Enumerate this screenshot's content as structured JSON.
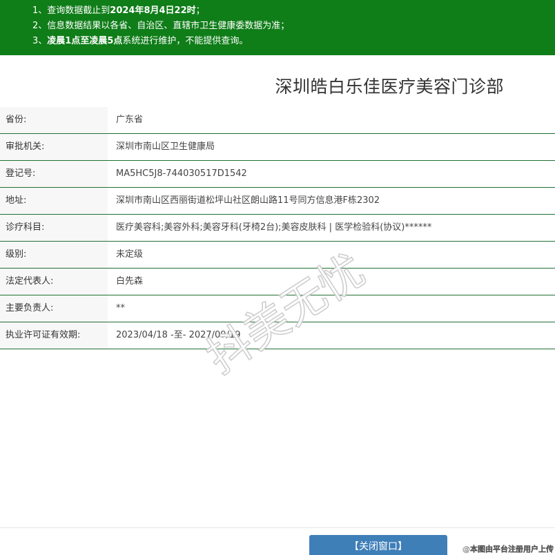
{
  "notice": {
    "line1_prefix": "1、查询数据截止到",
    "line1_bold": "2024年8月4日22时",
    "line1_suffix": "；",
    "line2": "2、信息数据结果以各省、自治区、直辖市卫生健康委数据为准；",
    "line3_prefix": "3、",
    "line3_bold": "凌晨1点至凌晨5点",
    "line3_suffix": "系统进行维护，不能提供查询。",
    "bg_color": "#0f7d18"
  },
  "title": "深圳皓白乐佳医疗美容门诊部",
  "rows": [
    {
      "label": "省份:",
      "value": "广东省"
    },
    {
      "label": "审批机关:",
      "value": "深圳市南山区卫生健康局"
    },
    {
      "label": "登记号:",
      "value": "MA5HC5J8-744030517D1542"
    },
    {
      "label": "地址:",
      "value": "深圳市南山区西丽街道松坪山社区朗山路11号同方信息港F栋2302"
    },
    {
      "label": "诊疗科目:",
      "value": "医疗美容科;美容外科;美容牙科(牙椅2台);美容皮肤科 | 医学检验科(协议)******"
    },
    {
      "label": "级别:",
      "value": "未定级"
    },
    {
      "label": "法定代表人:",
      "value": "白先森"
    },
    {
      "label": "主要负责人:",
      "value": "**"
    },
    {
      "label": "执业许可证有效期:",
      "value": "2023/04/18 -至- 2027/09/19"
    }
  ],
  "watermark_text": "抖美无忧",
  "close_button_label": "【关闭窗口】",
  "upload_note": "@本图由平台注册用户上传",
  "colors": {
    "row_border": "#1f6f33",
    "button": "#3f7fb8"
  }
}
